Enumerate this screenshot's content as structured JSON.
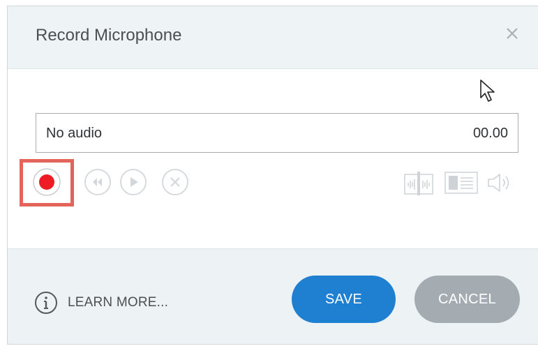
{
  "dialog": {
    "title": "Record Microphone",
    "close_icon": "close-icon"
  },
  "audio": {
    "status": "No audio",
    "time": "00.00"
  },
  "controls": {
    "record_icon": "record-icon",
    "rewind_icon": "rewind-icon",
    "play_icon": "play-icon",
    "delete_icon": "delete-icon",
    "waveform_icon": "waveform-icon",
    "caption_icon": "caption-icon",
    "volume_icon": "volume-icon"
  },
  "footer": {
    "learn_more_label": "LEARN MORE...",
    "save_label": "SAVE",
    "cancel_label": "CANCEL"
  },
  "colors": {
    "record_red": "#ed1c24",
    "highlight_border": "#e2645a",
    "save_blue": "#1f7fd1",
    "cancel_gray": "#a4acb1"
  }
}
